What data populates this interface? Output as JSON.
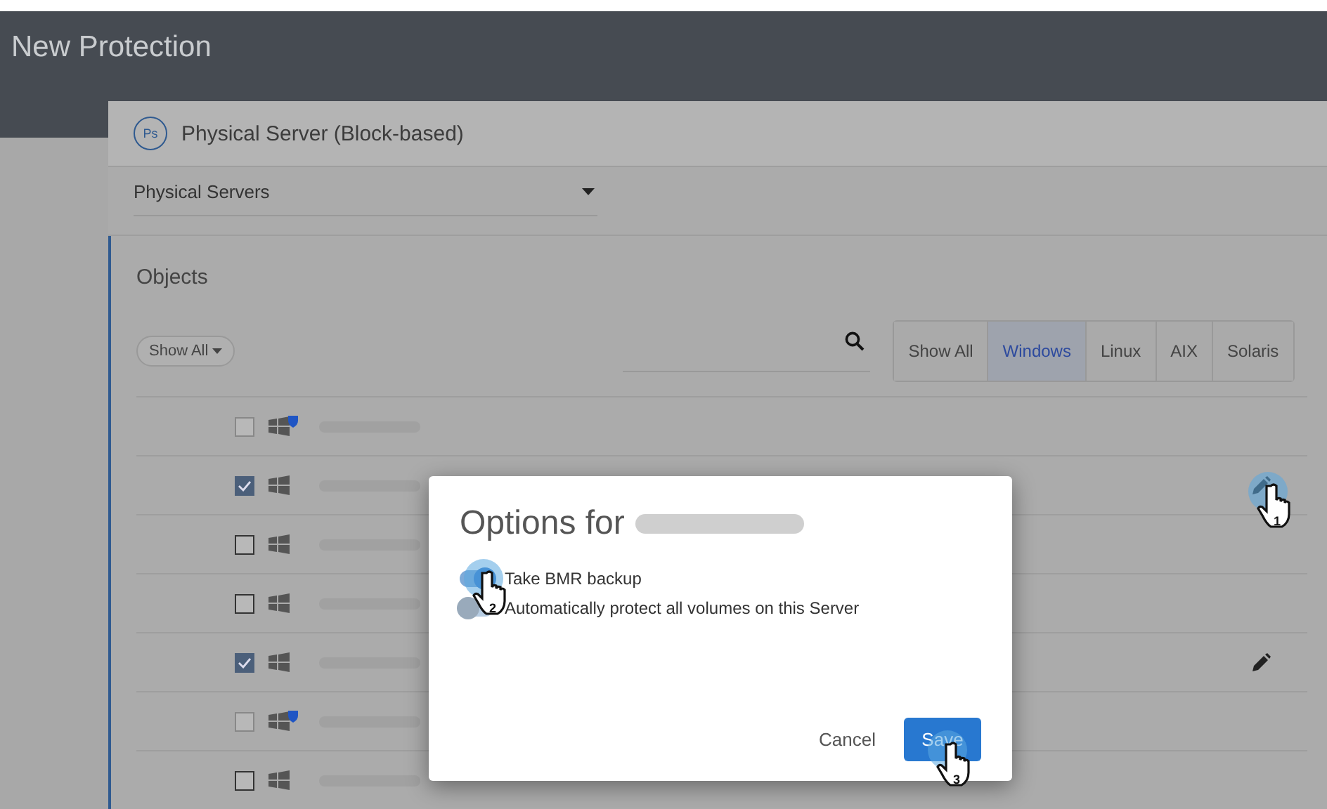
{
  "header": {
    "title": "New Protection"
  },
  "source": {
    "badge": "Ps",
    "title": "Physical Server (Block-based)"
  },
  "dropdown": {
    "value": "Physical Servers"
  },
  "objects": {
    "title": "Objects",
    "show_all": "Show All",
    "filters": [
      {
        "label": "Show All",
        "selected": false
      },
      {
        "label": "Windows",
        "selected": true
      },
      {
        "label": "Linux",
        "selected": false
      },
      {
        "label": "AIX",
        "selected": false
      },
      {
        "label": "Solaris",
        "selected": false
      }
    ],
    "rows": [
      {
        "checked": false,
        "disabled": true,
        "protected": true,
        "editable": false
      },
      {
        "checked": true,
        "disabled": false,
        "protected": false,
        "editable": true
      },
      {
        "checked": false,
        "disabled": false,
        "protected": false,
        "editable": false
      },
      {
        "checked": false,
        "disabled": false,
        "protected": false,
        "editable": false
      },
      {
        "checked": true,
        "disabled": false,
        "protected": false,
        "editable": true
      },
      {
        "checked": false,
        "disabled": true,
        "protected": true,
        "editable": false
      },
      {
        "checked": false,
        "disabled": false,
        "protected": false,
        "editable": false
      }
    ]
  },
  "dialog": {
    "title": "Options for",
    "options": [
      {
        "label": "Take BMR backup",
        "on": true
      },
      {
        "label": "Automatically protect all volumes on this Server",
        "on": false
      }
    ],
    "cancel": "Cancel",
    "save": "Save"
  },
  "cursors": [
    {
      "step": "1"
    },
    {
      "step": "2"
    },
    {
      "step": "3"
    }
  ]
}
